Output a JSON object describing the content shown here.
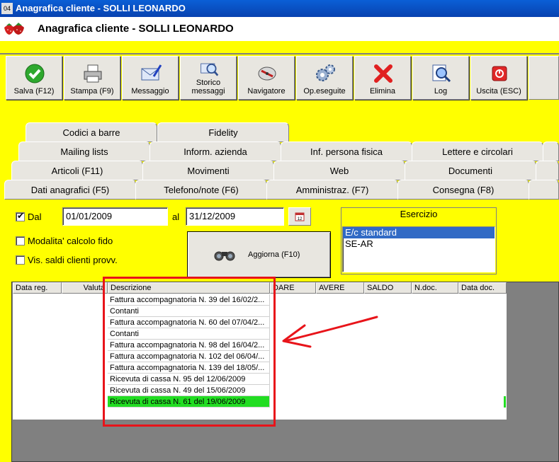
{
  "window": {
    "title": "Anagrafica cliente - SOLLI LEONARDO",
    "icon_text": "04"
  },
  "header": {
    "title": "Anagrafica cliente - SOLLI LEONARDO",
    "logo": "strawberry-logo"
  },
  "toolbar": {
    "buttons": [
      {
        "label": "Salva (F12)",
        "icon": "checkmark-icon"
      },
      {
        "label": "Stampa (F9)",
        "icon": "printer-icon"
      },
      {
        "label": "Messaggio",
        "icon": "envelope-pen-icon"
      },
      {
        "label": "Storico messaggi",
        "icon": "envelope-search-icon"
      },
      {
        "label": "Navigatore",
        "icon": "compass-icon"
      },
      {
        "label": "Op.eseguite",
        "icon": "gears-icon"
      },
      {
        "label": "Elimina",
        "icon": "red-x-icon"
      },
      {
        "label": "Log",
        "icon": "log-magnifier-icon"
      },
      {
        "label": "Uscita (ESC)",
        "icon": "exit-icon"
      }
    ]
  },
  "tabs": {
    "row1": [
      "Codici a barre",
      "Fidelity"
    ],
    "row2": [
      "Mailing lists",
      "Inform. azienda",
      "Inf. persona fisica",
      "Lettere e circolari"
    ],
    "row3": [
      "Articoli (F11)",
      "Movimenti",
      "Web",
      "Documenti"
    ],
    "row4": [
      "Dati anagrafici (F5)",
      "Telefono/note (F6)",
      "Amministraz. (F7)",
      "Consegna (F8)"
    ]
  },
  "filters": {
    "dal_label": "Dal",
    "dal_checked": true,
    "date_from": "01/01/2009",
    "al_label": "al",
    "date_to": "31/12/2009",
    "modalita_label": "Modalita' calcolo fido",
    "modalita_checked": false,
    "vis_saldi_label": "Vis. saldi clienti provv.",
    "vis_saldi_checked": false,
    "aggiorna_label": "Aggiorna (F10)"
  },
  "esercizio": {
    "title": "Esercizio",
    "options": [
      "E/c standard",
      "SE-AR"
    ],
    "selected": "E/c standard"
  },
  "grid": {
    "columns": [
      "Data reg.",
      "Valuta",
      "Descrizione",
      "DARE",
      "AVERE",
      "SALDO",
      "N.doc.",
      "Data doc."
    ],
    "rows": [
      {
        "descrizione": "Fattura accompagnatoria N. 39 del 16/02/2..."
      },
      {
        "descrizione": "Contanti"
      },
      {
        "descrizione": "Fattura accompagnatoria N. 60 del 07/04/2..."
      },
      {
        "descrizione": "Contanti"
      },
      {
        "descrizione": "Fattura accompagnatoria N. 98 del 16/04/2..."
      },
      {
        "descrizione": "Fattura accompagnatoria N. 102 del 06/04/..."
      },
      {
        "descrizione": "Fattura accompagnatoria N. 139 del 18/05/..."
      },
      {
        "descrizione": "Ricevuta di cassa N. 95 del 12/06/2009"
      },
      {
        "descrizione": "Ricevuta di cassa N. 49 del 15/06/2009"
      },
      {
        "descrizione": "Ricevuta di cassa N. 61 del 19/06/2009",
        "highlight": true
      }
    ],
    "highlight_color": "#22dd22"
  },
  "annotation": {
    "color": "#e8141a",
    "shape": "red-rectangle-with-arrow"
  }
}
